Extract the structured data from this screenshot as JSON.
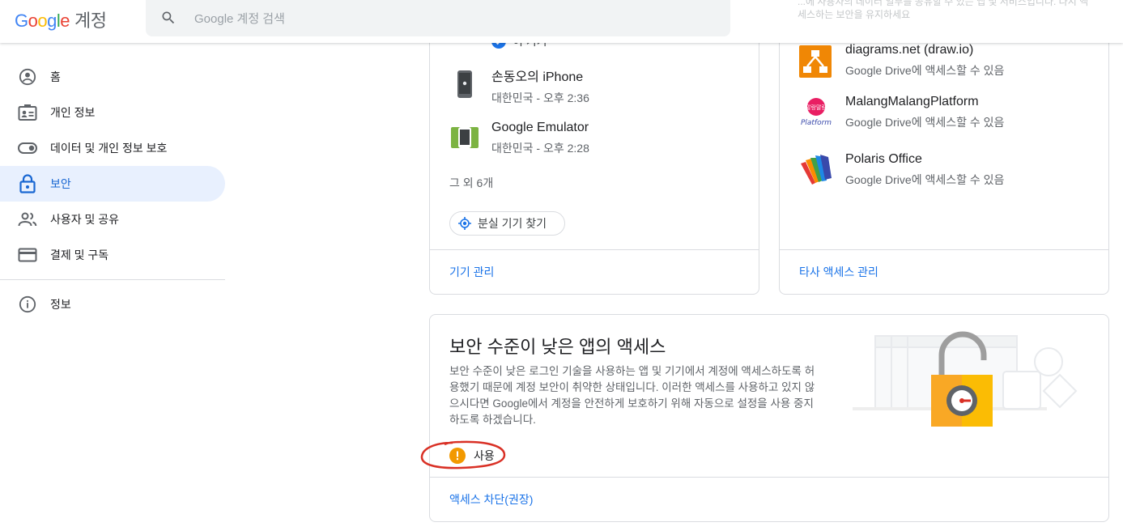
{
  "header": {
    "logo": "Google",
    "product": "계정",
    "search_placeholder": "Google 계정 검색",
    "top_right_text": "...에 사용자의 데이터 일부를 공유할 수 있는 앱 및 서비스입니다. 다시 액세스하는 보안을 유지하세요"
  },
  "sidebar": {
    "items": [
      {
        "label": "홈",
        "icon": "account-circle-icon"
      },
      {
        "label": "개인 정보",
        "icon": "id-card-icon"
      },
      {
        "label": "데이터 및 개인 정보 보호",
        "icon": "toggle-icon"
      },
      {
        "label": "보안",
        "icon": "lock-icon",
        "active": true
      },
      {
        "label": "사용자 및 공유",
        "icon": "people-icon"
      },
      {
        "label": "결제 및 구독",
        "icon": "credit-card-icon"
      }
    ],
    "footer_items": [
      {
        "label": "정보",
        "icon": "info-icon"
      }
    ]
  },
  "devices_card": {
    "partial_top_text": "이 기기",
    "devices": [
      {
        "name": "손동오의 iPhone",
        "location": "대한민국 - 오후 2:36",
        "icon": "iphone-icon"
      },
      {
        "name": "Google Emulator",
        "location": "대한민국 - 오후 2:28",
        "icon": "android-emulator-icon"
      }
    ],
    "more_count": "그 외 6개",
    "find_device_label": "분실 기기 찾기",
    "manage_link": "기기 관리"
  },
  "third_party_card": {
    "apps": [
      {
        "name": "diagrams.net (draw.io)",
        "access": "Google Drive에 액세스할 수 있음",
        "icon": "drawio-icon"
      },
      {
        "name": "MalangMalangPlatform",
        "access": "Google Drive에 액세스할 수 있음",
        "icon": "malang-platform-icon",
        "logo_top": "말랑말랑",
        "logo_bottom": "Platform"
      },
      {
        "name": "Polaris Office",
        "access": "Google Drive에 액세스할 수 있음",
        "icon": "polaris-office-icon"
      }
    ],
    "manage_link": "타사 액세스 관리"
  },
  "less_secure_card": {
    "title": "보안 수준이 낮은 앱의 액세스",
    "description": "보안 수준이 낮은 로그인 기술을 사용하는 앱 및 기기에서 계정에 액세스하도록 허용했기 때문에 계정 보안이 취약한 상태입니다. 이러한 액세스를 사용하고 있지 않으시다면 Google에서 계정을 안전하게 보호하기 위해 자동으로 설정을 사용 중지하도록 하겠습니다.",
    "status_label": "사용",
    "block_link": "액세스 차단(권장)"
  },
  "colors": {
    "accent": "#1a73e8",
    "active_nav_bg": "#e8f0fe",
    "warning": "#f29900",
    "annotation": "#d93025"
  }
}
